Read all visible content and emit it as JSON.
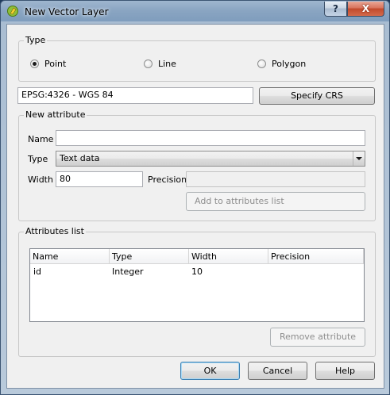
{
  "window": {
    "title": "New Vector Layer",
    "help_button": "?",
    "close_button": "X"
  },
  "type_group": {
    "title": "Type",
    "options": [
      {
        "label": "Point",
        "checked": true
      },
      {
        "label": "Line",
        "checked": false
      },
      {
        "label": "Polygon",
        "checked": false
      }
    ]
  },
  "crs": {
    "value": "EPSG:4326 - WGS 84",
    "specify_button": "Specify CRS"
  },
  "new_attribute": {
    "title": "New attribute",
    "name_label": "Name",
    "name_value": "",
    "type_label": "Type",
    "type_value": "Text data",
    "width_label": "Width",
    "width_value": "80",
    "precision_label": "Precision",
    "precision_value": "",
    "add_button": "Add to attributes list"
  },
  "attributes_list": {
    "title": "Attributes list",
    "columns": [
      "Name",
      "Type",
      "Width",
      "Precision"
    ],
    "rows": [
      [
        "id",
        "Integer",
        "10",
        ""
      ]
    ],
    "remove_button": "Remove attribute"
  },
  "footer": {
    "ok": "OK",
    "cancel": "Cancel",
    "help": "Help"
  },
  "icons": {
    "app": "qgis-icon"
  }
}
